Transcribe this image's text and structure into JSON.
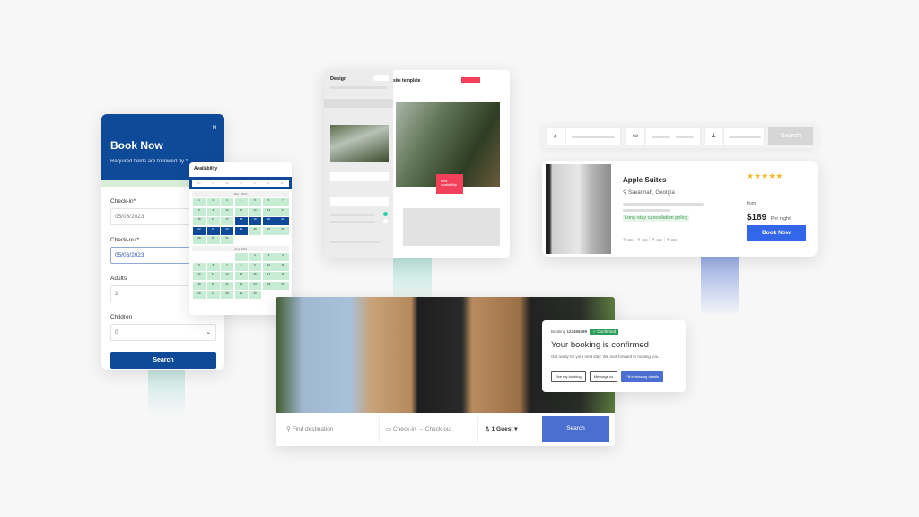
{
  "book_now": {
    "title": "Book Now",
    "subtitle": "Required fields are followed by *",
    "checkin_label": "Check-in*",
    "checkin_value": "05/06/2023",
    "checkout_label": "Check-out*",
    "checkout_value": "05/06/2023",
    "adults_label": "Adults",
    "adults_value": "1",
    "children_label": "Children",
    "children_value": "0",
    "search_label": "Search",
    "close_icon": "×"
  },
  "availability": {
    "title": "Availability",
    "weekdays": [
      "Mo",
      "Tu",
      "We",
      "Th",
      "Fr",
      "Sa",
      "Su"
    ],
    "month1": "May",
    "year1": "2023",
    "month2": "June 2023",
    "may_selected": [
      18,
      19,
      20,
      21,
      22,
      23,
      24,
      25
    ]
  },
  "design": {
    "title": "Design",
    "page_title": "site template",
    "find_label": "Find Availability"
  },
  "top_search": {
    "search_label": "Search"
  },
  "listing": {
    "name": "Apple Suites",
    "location": "Savannah, Georgia",
    "policy": "Long-stay cancellation policy",
    "rating": 5,
    "from": "from",
    "price": "$189",
    "per": "Per night",
    "book_label": "Book Now"
  },
  "confirmation": {
    "booking_label": "Booking",
    "booking_number": "123456789",
    "badge": "Confirmed",
    "title": "Your booking is confirmed",
    "message": "Get ready for your next stay. We look forward to hosting you.",
    "btn1": "See my booking",
    "btn2": "Message us",
    "btn3": "Fill in missing details"
  },
  "hero_search": {
    "destination_placeholder": "Find destination",
    "checkin": "Check-in",
    "arrow": "→",
    "checkout": "Check-out",
    "guests": "1 Guest",
    "search_label": "Search"
  },
  "colors": {
    "primary": "#0f4a99",
    "accent_red": "#f2405a",
    "accent_blue": "#3366e8",
    "teal": "#bfe6dc"
  }
}
